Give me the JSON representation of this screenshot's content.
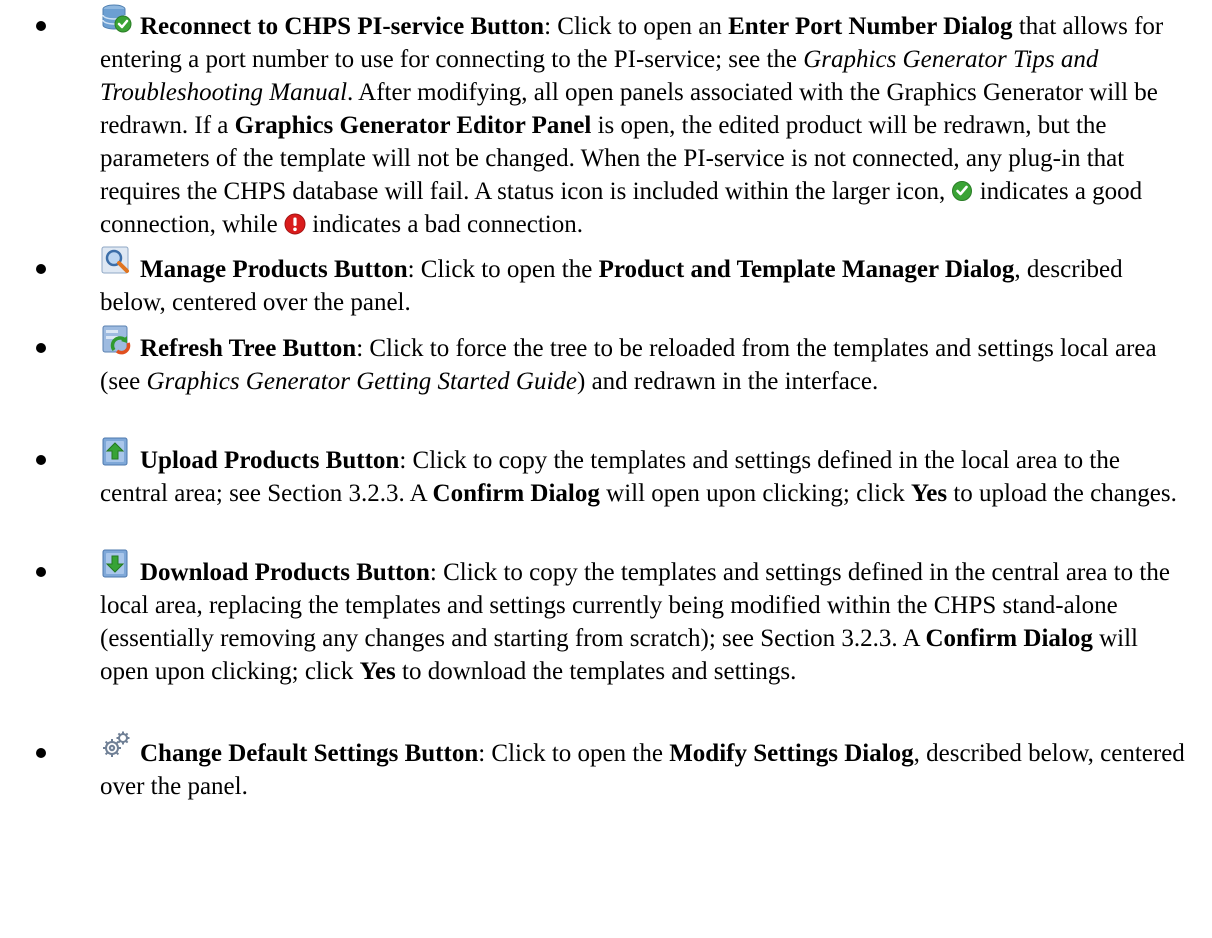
{
  "items": [
    {
      "icon": "database-check-icon",
      "title": "Reconnect to CHPS PI-service Button",
      "t1": ": Click to open an ",
      "b1": "Enter Port Number Dialog",
      "t2": " that allows for entering a port number to use for connecting to the PI-service; see the ",
      "i1": "Graphics Generator Tips and Troubleshooting Manual",
      "t3": ". After modifying, all open panels associated with the Graphics Generator will be redrawn. If a ",
      "b2": "Graphics Generator Editor Panel",
      "t4": " is open, the edited product will be redrawn, but the parameters of the template will not be changed. When the PI-service is not connected, any plug-in that requires the CHPS database will fail. A status icon is included within the larger icon, ",
      "good_icon": "green-check-icon",
      "t5": " indicates a good connection, while ",
      "bad_icon": "red-exclamation-icon",
      "t6": " indicates a bad connection."
    },
    {
      "icon": "magnifier-icon",
      "title": "Manage Products Button",
      "t1": ": Click to open the ",
      "b1": "Product and Template Manager Dialog",
      "t2": ", described below, centered over the panel."
    },
    {
      "icon": "refresh-tree-icon",
      "title": "Refresh Tree Button",
      "t1": ": Click to force the tree to be reloaded from the templates and settings local area (see ",
      "i1": "Graphics Generator Getting Started Guide",
      "t2": ") and redrawn in the interface."
    },
    {
      "icon": "upload-arrow-icon",
      "title": "Upload Products Button",
      "t1": ": Click to copy the templates and settings defined in the local area to the central area; see Section 3.2.3.  A ",
      "b1": "Confirm Dialog",
      "t2": " will open upon clicking; click ",
      "b2": "Yes",
      "t3": " to upload the changes."
    },
    {
      "icon": "download-arrow-icon",
      "title": "Download Products Button",
      "t1": ": Click to copy the templates and settings defined in the central area to the local area, replacing the templates and settings currently being modified within the CHPS stand-alone (essentially removing any changes and starting from scratch); see Section 3.2.3.  A ",
      "b1": "Confirm Dialog",
      "t2": " will open upon clicking; click ",
      "b2": "Yes",
      "t3": " to download the templates and settings."
    },
    {
      "icon": "gears-icon",
      "title": "Change Default Settings Button",
      "t1": ": Click to open the ",
      "b1": "Modify Settings Dialog",
      "t2": ", described below, centered over the panel."
    }
  ]
}
